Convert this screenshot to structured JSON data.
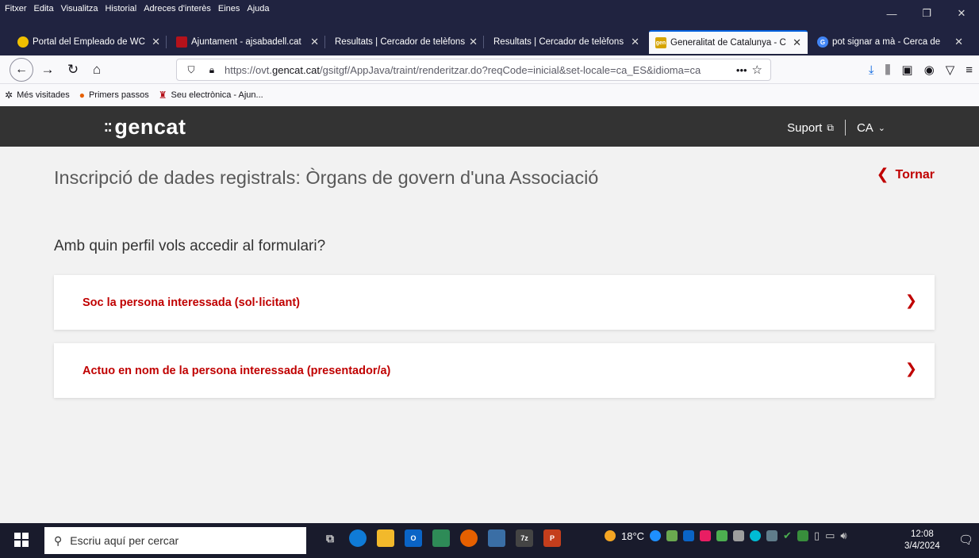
{
  "menubar": {
    "items": [
      "Fitxer",
      "Edita",
      "Visualitza",
      "Historial",
      "Adreces d'interès",
      "Eines",
      "Ajuda"
    ]
  },
  "tabs": [
    {
      "title": "Portal del Empleado de WC",
      "icon_color": "#f0c000",
      "icon_name": "clock-icon"
    },
    {
      "title": "Ajuntament - ajsabadell.cat",
      "icon_color": "#b5121b",
      "icon_name": "city-crest-icon"
    },
    {
      "title": "Resultats | Cercador de telèfons",
      "icon_color": "",
      "icon_name": ""
    },
    {
      "title": "Resultats | Cercador de telèfons",
      "icon_color": "",
      "icon_name": ""
    },
    {
      "title": "Generalitat de Catalunya - C",
      "icon_color": "#d6a400",
      "icon_name": "gencat-icon",
      "active": true
    },
    {
      "title": "pot signar a mà - Cerca de ",
      "icon_color": "#4285f4",
      "icon_name": "google-icon"
    }
  ],
  "navbar": {
    "url_prefix": "https://ovt.",
    "url_domain": "gencat.cat",
    "url_path": "/gsitgf/AppJava/traint/renderitzar.do?reqCode=inicial&set-locale=ca_ES&idioma=ca",
    "more": "•••"
  },
  "bookmarks": [
    {
      "label": "Més visitades",
      "icon": "gear-icon"
    },
    {
      "label": "Primers passos",
      "icon": "firefox-icon"
    },
    {
      "label": "Seu electrònica - Ajun...",
      "icon": "crest-icon"
    }
  ],
  "site_header": {
    "logo": "gencat",
    "support": "Suport",
    "language": "CA"
  },
  "page": {
    "title": "Inscripció de dades registrals: Òrgans de govern d'una Associació",
    "back_label": "Tornar",
    "question": "Amb quin perfil vols accedir al formulari?",
    "options": [
      "Soc la persona interessada (sol·licitant)",
      "Actuo en nom de la persona interessada (presentador/a)"
    ]
  },
  "taskbar": {
    "search_placeholder": "Escriu aquí per cercar",
    "temperature": "18°C",
    "time": "12:08",
    "date": "3/4/2024"
  },
  "colors": {
    "accent_red": "#c00000",
    "header_dark": "#333333",
    "tab_bar": "#202340"
  }
}
